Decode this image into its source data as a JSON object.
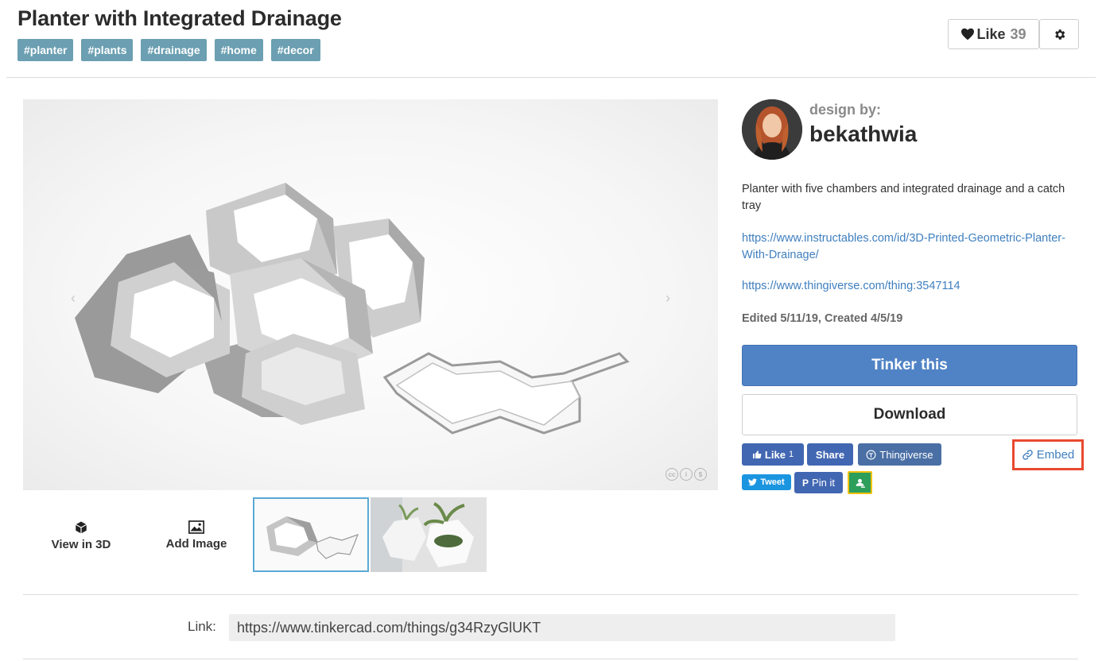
{
  "header": {
    "title": "Planter with Integrated Drainage",
    "tags": [
      "#planter",
      "#plants",
      "#drainage",
      "#home",
      "#decor"
    ],
    "like_label": "Like",
    "like_count": "39"
  },
  "gallery": {
    "view_3d_label": "View in 3D",
    "add_image_label": "Add Image"
  },
  "designer": {
    "design_by_label": "design by:",
    "username": "bekathwia"
  },
  "details": {
    "description": "Planter with five chambers and integrated drainage and a catch tray",
    "link_instructables": "https://www.instructables.com/id/3D-Printed-Geometric-Planter-With-Drainage/",
    "link_thingiverse": "https://www.thingiverse.com/thing:3547114",
    "dates": "Edited 5/11/19, Created 4/5/19"
  },
  "actions": {
    "tinker_label": "Tinker this",
    "download_label": "Download"
  },
  "social": {
    "fb_like_label": "Like",
    "fb_like_count": "1",
    "fb_share_label": "Share",
    "thingiverse_label": "Thingiverse",
    "tweet_label": "Tweet",
    "pin_label": "Pin it",
    "embed_label": "Embed"
  },
  "link_bar": {
    "label": "Link:",
    "value": "https://www.tinkercad.com/things/g34RzyGlUKT"
  },
  "colors": {
    "tag_bg": "#6b9fb1",
    "primary_button": "#5083c5",
    "link": "#3f7fbf",
    "embed_highlight": "#e8492f",
    "facebook": "#4267b2",
    "twitter": "#1b95e0"
  }
}
